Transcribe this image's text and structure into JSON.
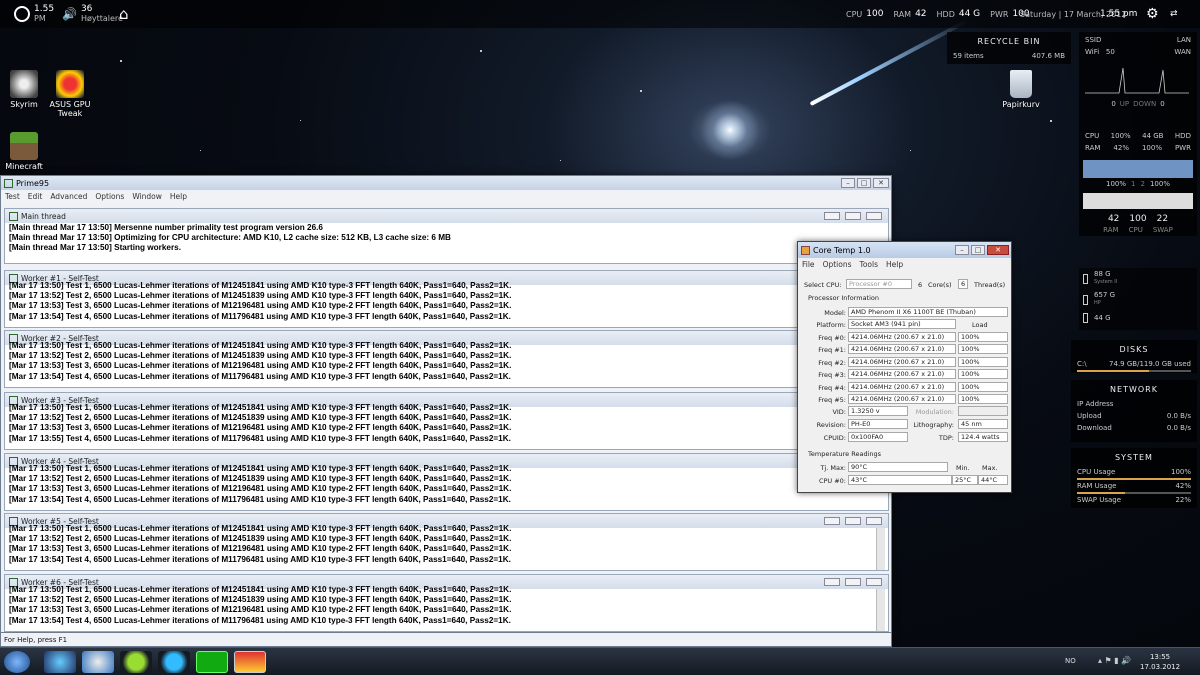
{
  "topbar": {
    "time": "1.55",
    "ampm": "PM",
    "volume": "36",
    "volume_label": "Høyttalere",
    "cpu_label": "CPU",
    "cpu": "100",
    "ram_label": "RAM",
    "ram": "42",
    "hdd_label": "HDD",
    "hdd": "44 G",
    "pwr_label": "PWR",
    "pwr": "100",
    "date": "Saturday | 17 March, 2012",
    "clock": "1.55 pm"
  },
  "desktop": {
    "icons": [
      {
        "label": "Skyrim"
      },
      {
        "label": "ASUS GPU Tweak"
      },
      {
        "label": "Minecraft"
      },
      {
        "label": "Papirkurv"
      }
    ]
  },
  "recycle": {
    "title": "RECYCLE BIN",
    "items": "59 items",
    "size": "407.6 MB"
  },
  "net_widget": {
    "ssid": "SSID",
    "lan": "LAN",
    "wifi": "WiFi",
    "wifi_val": "50",
    "wan": "WAN",
    "up_val": "0",
    "up": "UP",
    "down": "DOWN",
    "down_val": "0"
  },
  "stats_widget": {
    "cpu": "CPU",
    "cpu_val": "100%",
    "hdd_val": "44 GB",
    "hdd": "HDD",
    "ram": "RAM",
    "ram_val": "42%",
    "pwr_val": "100%",
    "pwr": "PWR",
    "core1": "100%",
    "sep1": "1",
    "sep2": "2",
    "core2": "100%",
    "b1": "42",
    "b2": "100",
    "b3": "22",
    "l1": "RAM",
    "l2": "CPU",
    "l3": "SWAP"
  },
  "drives": [
    {
      "size": "88 G",
      "name": "System II"
    },
    {
      "size": "657 G",
      "name": "HP"
    },
    {
      "size": "44 G",
      "name": ""
    }
  ],
  "disks": {
    "title": "DISKS",
    "drive": "C:\\",
    "usage": "74.9 GB/119.0 GB used"
  },
  "network": {
    "title": "NETWORK",
    "ip": "IP Address",
    "upload": "Upload",
    "upload_val": "0.0 B/s",
    "download": "Download",
    "download_val": "0.0 B/s"
  },
  "system": {
    "title": "SYSTEM",
    "cpu": "CPU Usage",
    "cpu_val": "100%",
    "ram": "RAM Usage",
    "ram_val": "42%",
    "swap": "SWAP Usage",
    "swap_val": "22%"
  },
  "prime95": {
    "title": "Prime95",
    "menu": [
      "Test",
      "Edit",
      "Advanced",
      "Options",
      "Window",
      "Help"
    ],
    "status": "For Help, press F1",
    "main": {
      "title": "Main thread",
      "lines": [
        "[Main thread Mar 17 13:50] Mersenne number primality test program version 26.6",
        "[Main thread Mar 17 13:50] Optimizing for CPU architecture: AMD K10, L2 cache size: 512 KB, L3 cache size: 6 MB",
        "[Main thread Mar 17 13:50] Starting workers."
      ]
    },
    "workers": [
      {
        "title": "Worker #1 - Self-Test",
        "lines": [
          "[Mar 17 13:50] Test 1, 6500 Lucas-Lehmer iterations of M12451841 using AMD K10 type-3 FFT length 640K, Pass1=640, Pass2=1K.",
          "[Mar 17 13:52] Test 2, 6500 Lucas-Lehmer iterations of M12451839 using AMD K10 type-3 FFT length 640K, Pass1=640, Pass2=1K.",
          "[Mar 17 13:53] Test 3, 6500 Lucas-Lehmer iterations of M12196481 using AMD K10 type-2 FFT length 640K, Pass1=640, Pass2=1K.",
          "[Mar 17 13:54] Test 4, 6500 Lucas-Lehmer iterations of M11796481 using AMD K10 type-3 FFT length 640K, Pass1=640, Pass2=1K."
        ]
      },
      {
        "title": "Worker #2 - Self-Test",
        "lines": [
          "[Mar 17 13:50] Test 1, 6500 Lucas-Lehmer iterations of M12451841 using AMD K10 type-3 FFT length 640K, Pass1=640, Pass2=1K.",
          "[Mar 17 13:52] Test 2, 6500 Lucas-Lehmer iterations of M12451839 using AMD K10 type-3 FFT length 640K, Pass1=640, Pass2=1K.",
          "[Mar 17 13:53] Test 3, 6500 Lucas-Lehmer iterations of M12196481 using AMD K10 type-2 FFT length 640K, Pass1=640, Pass2=1K.",
          "[Mar 17 13:54] Test 4, 6500 Lucas-Lehmer iterations of M11796481 using AMD K10 type-3 FFT length 640K, Pass1=640, Pass2=1K."
        ]
      },
      {
        "title": "Worker #3 - Self-Test",
        "lines": [
          "[Mar 17 13:50] Test 1, 6500 Lucas-Lehmer iterations of M12451841 using AMD K10 type-3 FFT length 640K, Pass1=640, Pass2=1K.",
          "[Mar 17 13:52] Test 2, 6500 Lucas-Lehmer iterations of M12451839 using AMD K10 type-3 FFT length 640K, Pass1=640, Pass2=1K.",
          "[Mar 17 13:53] Test 3, 6500 Lucas-Lehmer iterations of M12196481 using AMD K10 type-2 FFT length 640K, Pass1=640, Pass2=1K.",
          "[Mar 17 13:55] Test 4, 6500 Lucas-Lehmer iterations of M11796481 using AMD K10 type-3 FFT length 640K, Pass1=640, Pass2=1K."
        ]
      },
      {
        "title": "Worker #4 - Self-Test",
        "lines": [
          "[Mar 17 13:50] Test 1, 6500 Lucas-Lehmer iterations of M12451841 using AMD K10 type-3 FFT length 640K, Pass1=640, Pass2=1K.",
          "[Mar 17 13:52] Test 2, 6500 Lucas-Lehmer iterations of M12451839 using AMD K10 type-3 FFT length 640K, Pass1=640, Pass2=1K.",
          "[Mar 17 13:53] Test 3, 6500 Lucas-Lehmer iterations of M12196481 using AMD K10 type-2 FFT length 640K, Pass1=640, Pass2=1K.",
          "[Mar 17 13:54] Test 4, 6500 Lucas-Lehmer iterations of M11796481 using AMD K10 type-3 FFT length 640K, Pass1=640, Pass2=1K."
        ]
      },
      {
        "title": "Worker #5 - Self-Test",
        "lines": [
          "[Mar 17 13:50] Test 1, 6500 Lucas-Lehmer iterations of M12451841 using AMD K10 type-3 FFT length 640K, Pass1=640, Pass2=1K.",
          "[Mar 17 13:52] Test 2, 6500 Lucas-Lehmer iterations of M12451839 using AMD K10 type-3 FFT length 640K, Pass1=640, Pass2=1K.",
          "[Mar 17 13:53] Test 3, 6500 Lucas-Lehmer iterations of M12196481 using AMD K10 type-2 FFT length 640K, Pass1=640, Pass2=1K.",
          "[Mar 17 13:54] Test 4, 6500 Lucas-Lehmer iterations of M11796481 using AMD K10 type-3 FFT length 640K, Pass1=640, Pass2=1K."
        ]
      },
      {
        "title": "Worker #6 - Self-Test",
        "lines": [
          "[Mar 17 13:50] Test 1, 6500 Lucas-Lehmer iterations of M12451841 using AMD K10 type-3 FFT length 640K, Pass1=640, Pass2=1K.",
          "[Mar 17 13:52] Test 2, 6500 Lucas-Lehmer iterations of M12451839 using AMD K10 type-3 FFT length 640K, Pass1=640, Pass2=1K.",
          "[Mar 17 13:53] Test 3, 6500 Lucas-Lehmer iterations of M12196481 using AMD K10 type-2 FFT length 640K, Pass1=640, Pass2=1K.",
          "[Mar 17 13:54] Test 4, 6500 Lucas-Lehmer iterations of M11796481 using AMD K10 type-3 FFT length 640K, Pass1=640, Pass2=1K."
        ]
      }
    ]
  },
  "coretemp": {
    "title": "Core Temp 1.0",
    "menu": [
      "File",
      "Options",
      "Tools",
      "Help"
    ],
    "select_cpu": "Select CPU:",
    "processor": "Processor #0",
    "cores_n": "6",
    "cores": "Core(s)",
    "threads_n": "6",
    "threads": "Thread(s)",
    "section_info": "Processor Information",
    "model_label": "Model:",
    "model": "AMD Phenom II X6 1100T BE (Thuban)",
    "platform_label": "Platform:",
    "platform": "Socket AM3 (941 pin)",
    "load_label": "Load",
    "freqs": [
      {
        "label": "Freq #0:",
        "value": "4214.06MHz (200.67 x 21.0)",
        "load": "100%"
      },
      {
        "label": "Freq #1:",
        "value": "4214.06MHz (200.67 x 21.0)",
        "load": "100%"
      },
      {
        "label": "Freq #2:",
        "value": "4214.06MHz (200.67 x 21.0)",
        "load": "100%"
      },
      {
        "label": "Freq #3:",
        "value": "4214.06MHz (200.67 x 21.0)",
        "load": "100%"
      },
      {
        "label": "Freq #4:",
        "value": "4214.06MHz (200.67 x 21.0)",
        "load": "100%"
      },
      {
        "label": "Freq #5:",
        "value": "4214.06MHz (200.67 x 21.0)",
        "load": "100%"
      }
    ],
    "vid_label": "VID:",
    "vid": "1.3250 v",
    "modulation_label": "Modulation:",
    "revision_label": "Revision:",
    "revision": "PH-E0",
    "litho_label": "Lithography:",
    "litho": "45 nm",
    "cpuid_label": "CPUID:",
    "cpuid": "0x100FA0",
    "tdp_label": "TDP:",
    "tdp": "124.4 watts",
    "section_temp": "Temperature Readings",
    "tj_label": "Tj. Max:",
    "tj": "90°C",
    "min_label": "Min.",
    "max_label": "Max.",
    "cpu0_label": "CPU #0:",
    "cpu0": "43°C",
    "cpu0_min": "25°C",
    "cpu0_max": "44°C"
  },
  "taskbar": {
    "lang": "NO",
    "time": "13:55",
    "date": "17.03.2012"
  }
}
